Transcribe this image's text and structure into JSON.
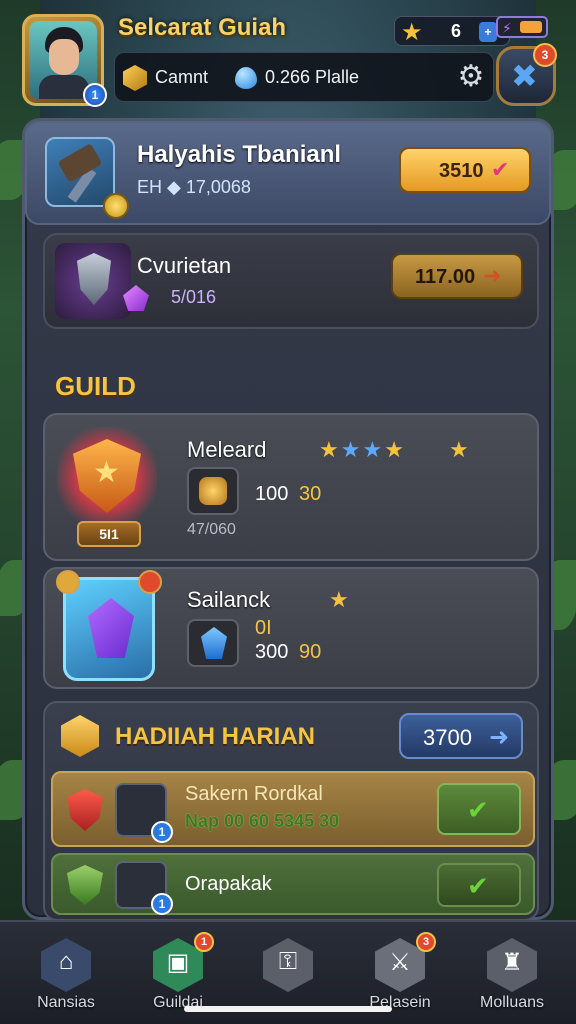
{
  "header": {
    "player_name": "Selcarat Guiah",
    "stars_count": "6",
    "chip_plus": "+",
    "stat_label": "Camnt",
    "stat_value": "0.266 Plalle",
    "avatar_badge": "1",
    "quest_badge": "3"
  },
  "offers": [
    {
      "title": "Halyahis Tbanianl",
      "sub": "EH ◆ 17,0068",
      "price": "3510"
    },
    {
      "title": "Cvurietan",
      "sub": "5/016",
      "price": "117.00"
    }
  ],
  "guild": {
    "heading": "GUILD",
    "cards": [
      {
        "name": "Meleard",
        "emblem_label": "5I1",
        "value_a": "100",
        "value_b": "30",
        "sub": "47/060"
      },
      {
        "name": "Sailanck",
        "value_top": "0I",
        "value_a": "300",
        "value_b": "90"
      }
    ]
  },
  "daily": {
    "heading": "HADIIAH HARIAN",
    "button_label": "3700",
    "rewards": [
      {
        "title": "Sakern Rordkal",
        "sub": "Nap 00 60 5345 30",
        "badge": "1"
      },
      {
        "title": "Orapakak",
        "badge": "1"
      }
    ]
  },
  "nav": [
    {
      "label": "Nansias",
      "icon": "home-icon",
      "glyph": "⌂",
      "color": "#3a4a6a"
    },
    {
      "label": "Guildai",
      "icon": "guild-icon",
      "glyph": "▣",
      "color": "#2f8a5a",
      "badge": "1"
    },
    {
      "label": "",
      "icon": "lock-icon",
      "glyph": "⚿",
      "color": "#5a5f6a"
    },
    {
      "label": "Pelasein",
      "icon": "quest-icon",
      "glyph": "⚔",
      "color": "#6a6f7a",
      "badge": "3"
    },
    {
      "label": "Molluans",
      "icon": "castle-icon",
      "glyph": "♜",
      "color": "#5a5f6a"
    }
  ],
  "colors": {
    "accent_gold": "#f4c542",
    "primary_blue": "#3b7bd9",
    "panel_bg": "#2b303d"
  }
}
